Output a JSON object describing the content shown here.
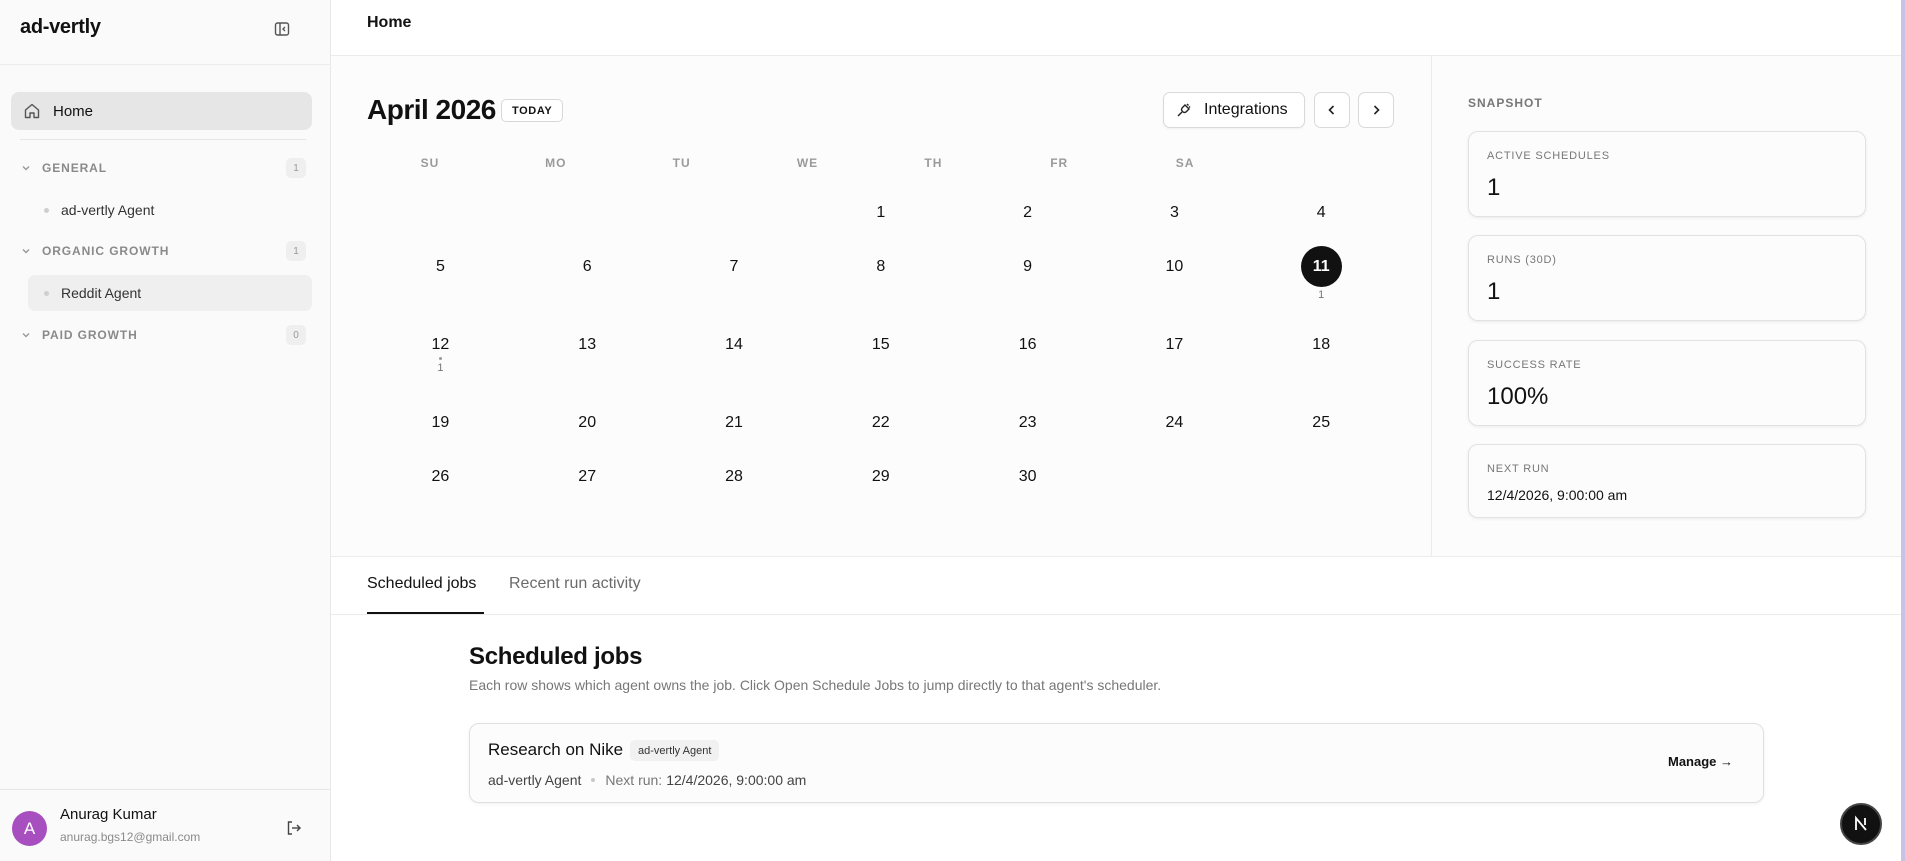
{
  "app": {
    "brand": "ad-vertly"
  },
  "sidebar": {
    "home_label": "Home",
    "groups": [
      {
        "name": "GENERAL",
        "count": "1",
        "agents": [
          "ad-vertly Agent"
        ]
      },
      {
        "name": "ORGANIC GROWTH",
        "count": "1",
        "agents": [
          "Reddit Agent"
        ]
      },
      {
        "name": "PAID GROWTH",
        "count": "0",
        "agents": []
      }
    ],
    "user": {
      "initial": "A",
      "name": "Anurag Kumar",
      "email": "anurag.bgs12@gmail.com"
    }
  },
  "topbar": {
    "breadcrumb": "Home"
  },
  "calendar": {
    "month_label": "April 2026",
    "today_label": "TODAY",
    "integrations_label": "Integrations",
    "weekdays": [
      "SU",
      "MO",
      "TU",
      "WE",
      "TH",
      "FR",
      "SA"
    ],
    "days": [
      "1",
      "2",
      "3",
      "4",
      "5",
      "6",
      "7",
      "8",
      "9",
      "10",
      "11",
      "12",
      "13",
      "14",
      "15",
      "16",
      "17",
      "18",
      "19",
      "20",
      "21",
      "22",
      "23",
      "24",
      "25",
      "26",
      "27",
      "28",
      "29",
      "30"
    ],
    "today": "11",
    "run_counts": {
      "11": "1",
      "12": "1"
    }
  },
  "snapshot": {
    "title": "SNAPSHOT",
    "cards": [
      {
        "label": "ACTIVE SCHEDULES",
        "value": "1"
      },
      {
        "label": "RUNS (30D)",
        "value": "1"
      },
      {
        "label": "SUCCESS RATE",
        "value": "100%"
      },
      {
        "label": "NEXT RUN",
        "value": "12/4/2026, 9:00:00 am"
      }
    ]
  },
  "tabs": {
    "scheduled": "Scheduled jobs",
    "recent": "Recent run activity"
  },
  "jobs": {
    "title": "Scheduled jobs",
    "description": "Each row shows which agent owns the job. Click Open Schedule Jobs to jump directly to that agent's scheduler.",
    "items": [
      {
        "name": "Research on Nike",
        "badge": "ad-vertly Agent",
        "agent": "ad-vertly Agent",
        "next_run_label": "Next run:",
        "next_run_value": "12/4/2026, 9:00:00 am",
        "manage_label": "Manage →"
      }
    ]
  },
  "fab": {
    "letter": "N"
  }
}
